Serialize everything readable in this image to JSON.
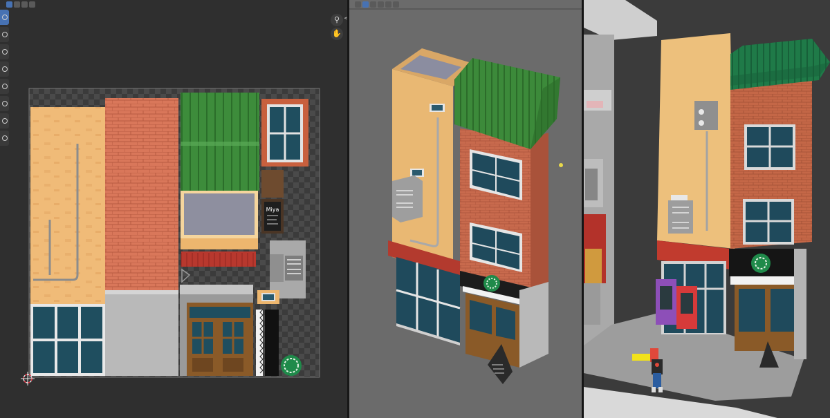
{
  "uv_editor": {
    "header_icons": [
      "select-box-icon",
      "extend-icon",
      "subtract-icon",
      "invert-icon"
    ],
    "tools": [
      "select-box-icon",
      "cursor-icon",
      "move-icon",
      "rotate-icon",
      "scale-icon",
      "transform-icon",
      "annotate-icon",
      "rip-icon"
    ],
    "zoom_icon": "magnifier-icon",
    "pan_icon": "hand-icon",
    "sign_text": "Miya",
    "collapse_glyph": "<>"
  },
  "viewport": {
    "header_icons": [
      "select-box-icon",
      "extend-icon",
      "subtract-icon",
      "invert-icon",
      "intersect-icon"
    ]
  },
  "render": {}
}
